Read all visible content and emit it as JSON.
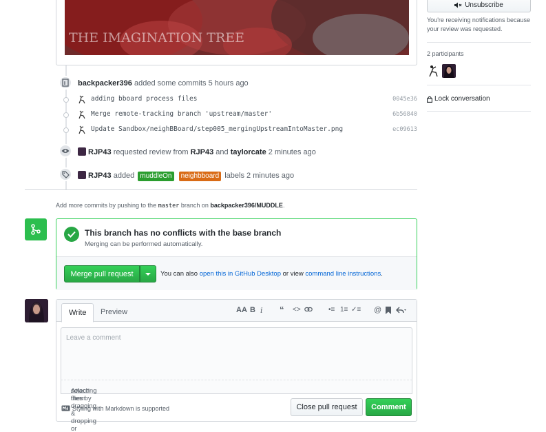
{
  "hero": {
    "caption": "THE IMAGINATION TREE"
  },
  "timeline": {
    "commits_event": {
      "user": "backpacker396",
      "text": "added some commits",
      "time": "5 hours ago"
    },
    "commits": [
      {
        "message": "adding bboard process files",
        "sha": "0045e36"
      },
      {
        "message": "Merge remote-tracking branch 'upstream/master'",
        "sha": "6b56840"
      },
      {
        "message": "Update Sandbox/neighBBoard/step005_mergingUpstreamIntoMaster.png",
        "sha": "ec09613"
      }
    ],
    "review_event": {
      "user": "RJP43",
      "text": "requested review from",
      "reviewer1": "RJP43",
      "and": "and",
      "reviewer2": "taylorcate",
      "time": "2 minutes ago"
    },
    "label_event": {
      "user": "RJP43",
      "added": "added",
      "labels": [
        {
          "name": "muddleOn",
          "color": "#2a9d2e"
        },
        {
          "name": "neighbboard",
          "color": "#d96b16"
        }
      ],
      "suffix": "labels 2 minutes ago"
    }
  },
  "push_hint": {
    "prefix": "Add more commits by pushing to the",
    "branch": "master",
    "middle": "branch on",
    "repo": "backpacker396/MUDDLE",
    "suffix": "."
  },
  "merge": {
    "title": "This branch has no conflicts with the base branch",
    "subtitle": "Merging can be performed automatically.",
    "button": "Merge pull request",
    "alt_prefix": "You can also",
    "alt_link1": "open this in GitHub Desktop",
    "alt_middle": "or view",
    "alt_link2": "command line instructions",
    "alt_suffix": "."
  },
  "comment": {
    "tab_write": "Write",
    "tab_preview": "Preview",
    "toolbar": [
      "AA",
      "B",
      "i",
      "“",
      "<>",
      "link",
      "•≡",
      "1≡",
      "✓≡",
      "@",
      "bookmark",
      "reply"
    ],
    "placeholder": "Leave a comment",
    "attach_prefix": "Attach files by dragging & dropping or",
    "attach_link": "selecting them",
    "attach_suffix": ".",
    "markdown_hint": "Styling with Markdown is supported",
    "close_button": "Close pull request",
    "comment_button": "Comment"
  },
  "sidebar": {
    "unsubscribe": "Unsubscribe",
    "notif_reason": "You're receiving notifications because your review was requested.",
    "participants_title": "2 participants",
    "lock": "Lock conversation"
  },
  "colors": {
    "green": "#28a745",
    "link": "#0366d6"
  }
}
